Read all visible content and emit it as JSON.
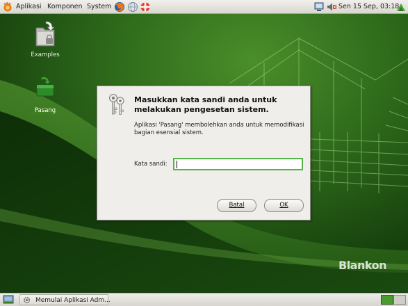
{
  "top_panel": {
    "menus": [
      "Aplikasi",
      "Komponen",
      "System"
    ],
    "clock": "Sen 15 Sep, 03:18",
    "icons": [
      "foot-logo-icon",
      "firefox-icon",
      "network-icon",
      "help-lifebuoy-icon",
      "computer-update-icon",
      "volume-muted-icon",
      "network-status-icon"
    ]
  },
  "desktop": {
    "icons": [
      {
        "label": "Examples",
        "icon": "examples-folder-icon"
      },
      {
        "label": "Pasang",
        "icon": "installer-icon"
      }
    ],
    "brand": "Blankon"
  },
  "dialog": {
    "title": "Masukkan kata sandi anda untuk melakukan pengesetan sistem.",
    "description": "Aplikasi 'Pasang' membolehkan anda untuk memodifikasi bagian esensial sistem.",
    "password_label": "Kata sandi:",
    "password_value": "",
    "cancel_label": "Batal",
    "ok_label": "OK",
    "icon": "keys-icon"
  },
  "bottom_panel": {
    "task_label": "Memulai Aplikasi Adm...",
    "icons": [
      "show-desktop-icon",
      "busy-gear-icon",
      "workspace-switcher-icon"
    ]
  },
  "colors": {
    "desktop_green": "#1e4f13",
    "accent_green": "#58b347",
    "panel_gray": "#e4e2dc"
  }
}
